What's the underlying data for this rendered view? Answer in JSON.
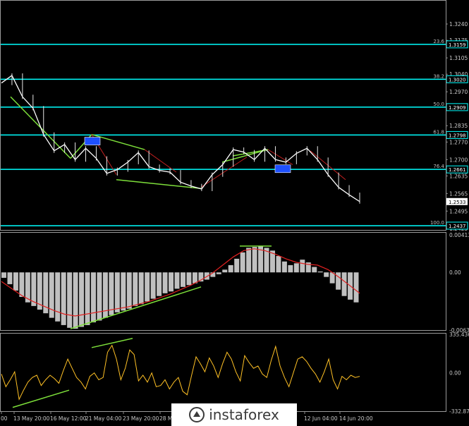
{
  "chart_data": [
    {
      "type": "line",
      "panel": "price",
      "price_axis_ticks": [
        "1.3240",
        "1.3175",
        "1.3105",
        "1.3040",
        "1.2970",
        "1.2905",
        "1.2835",
        "1.2770",
        "1.2700",
        "1.2635",
        "1.2565",
        "1.2495",
        "1.2425"
      ],
      "ylim": [
        1.242,
        1.3285
      ],
      "current_price": "1.2533",
      "fib_levels": [
        {
          "label": "23.6",
          "value": "1.3159",
          "price": 1.3159
        },
        {
          "label": "38.2",
          "value": "1.3020",
          "price": 1.302
        },
        {
          "label": "50.0",
          "value": "1.2909",
          "price": 1.2909
        },
        {
          "label": "61.8",
          "value": "1.2798",
          "price": 1.2798
        },
        {
          "label": "76.4",
          "value": "1.2661",
          "price": 1.2661
        },
        {
          "label": "100.0",
          "value": "1.2437",
          "price": 1.2437
        }
      ],
      "price_path": [
        1.3005,
        1.3035,
        1.295,
        1.2905,
        1.28,
        1.2735,
        1.276,
        1.27,
        1.2745,
        1.2705,
        1.2645,
        1.266,
        1.269,
        1.2728,
        1.2672,
        1.2657,
        1.265,
        1.261,
        1.2595,
        1.2583,
        1.264,
        1.268,
        1.274,
        1.273,
        1.27,
        1.2745,
        1.27,
        1.269,
        1.2725,
        1.2745,
        1.27,
        1.264,
        1.259,
        1.256,
        1.2533
      ]
    },
    {
      "type": "bar",
      "panel": "macd",
      "axis_ticks": [
        "0.00413",
        "0.00",
        "-0.00635"
      ],
      "ylim": [
        -0.00635,
        0.00413
      ],
      "values": [
        -0.0006,
        -0.0013,
        -0.002,
        -0.0027,
        -0.0033,
        -0.0037,
        -0.0041,
        -0.0045,
        -0.005,
        -0.0054,
        -0.0058,
        -0.0061,
        -0.0062,
        -0.006,
        -0.0058,
        -0.0055,
        -0.0053,
        -0.005,
        -0.0047,
        -0.0044,
        -0.0042,
        -0.004,
        -0.0037,
        -0.0035,
        -0.0032,
        -0.0029,
        -0.0026,
        -0.0023,
        -0.0021,
        -0.0018,
        -0.0016,
        -0.0014,
        -0.0012,
        -0.001,
        -0.0008,
        -0.0005,
        -0.0002,
        0.0003,
        0.0008,
        0.0015,
        0.0022,
        0.0027,
        0.0028,
        0.0029,
        0.0027,
        0.0024,
        0.0018,
        0.0012,
        0.0008,
        0.001,
        0.0014,
        0.0011,
        0.0006,
        0.0001,
        -0.0005,
        -0.0012,
        -0.0019,
        -0.0026,
        -0.003,
        -0.0033
      ],
      "signal": [
        -0.001,
        -0.0018,
        -0.0026,
        -0.0032,
        -0.0037,
        -0.0042,
        -0.0046,
        -0.0048,
        -0.0046,
        -0.0044,
        -0.0042,
        -0.004,
        -0.0038,
        -0.0035,
        -0.0032,
        -0.0028,
        -0.0024,
        -0.0019,
        -0.0014,
        -0.0008,
        -0.0001,
        0.0008,
        0.0017,
        0.0024,
        0.0026,
        0.0024,
        0.002,
        0.0015,
        0.0011,
        0.0009,
        0.0008,
        0.0003,
        -0.0005,
        -0.0014,
        -0.0023
      ]
    },
    {
      "type": "line",
      "panel": "cci",
      "axis_ticks": [
        "335.4369",
        "0.00",
        "-332.874"
      ],
      "ylim": [
        -332.874,
        335.4369
      ],
      "values": [
        -10,
        -120,
        -60,
        10,
        -230,
        -150,
        -80,
        -40,
        -20,
        -110,
        -60,
        -20,
        -50,
        -90,
        20,
        120,
        40,
        -40,
        -80,
        -140,
        -30,
        0,
        -60,
        -40,
        180,
        240,
        120,
        -60,
        40,
        200,
        160,
        -70,
        -20,
        -80,
        0,
        -120,
        -110,
        -60,
        -140,
        -80,
        -40,
        -160,
        -190,
        -20,
        140,
        80,
        10,
        130,
        60,
        -40,
        80,
        180,
        120,
        10,
        -70,
        150,
        90,
        40,
        60,
        -10,
        -40,
        110,
        230,
        60,
        -40,
        -120,
        0,
        120,
        140,
        100,
        40,
        -10,
        -80,
        10,
        120,
        -60,
        -140,
        -30,
        -60,
        -20,
        -40,
        -30
      ]
    }
  ],
  "x_axis_labels": [
    "00",
    "13 May 20:00",
    "16 May 12:00",
    "21 May 04:00",
    "23 May 20:00",
    "28 Ma",
    "12 Jun 04:00",
    "14 Jun 20:00"
  ],
  "watermark": {
    "brand": "instaforex"
  },
  "colors": {
    "fib_line": "#00ffff",
    "trend_line": "#7ddf3a",
    "price_line": "#ffffff",
    "macd_hist": "#c0c0c0",
    "macd_signal": "#e02020",
    "cci_line": "#ffc125",
    "marker": "#1e50ff",
    "grid": "#404040"
  }
}
